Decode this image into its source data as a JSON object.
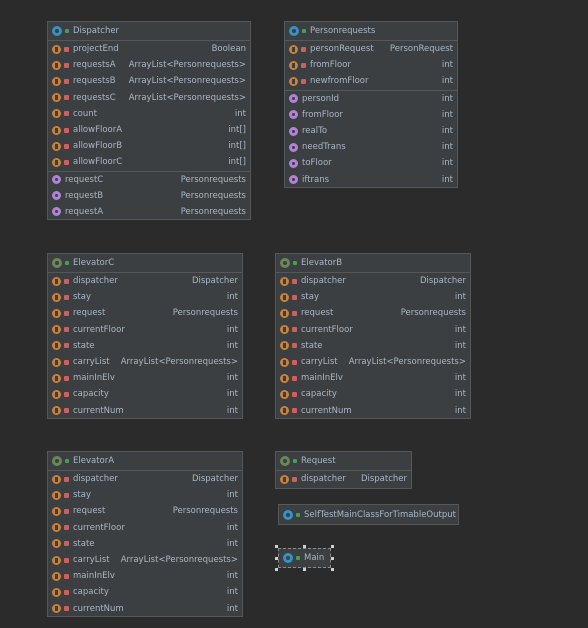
{
  "classes": {
    "dispatcher": {
      "title": "Dispatcher",
      "fields": [
        {
          "name": "projectEnd",
          "type": "Boolean"
        },
        {
          "name": "requestsA",
          "type": "ArrayList<Personrequests>"
        },
        {
          "name": "requestsB",
          "type": "ArrayList<Personrequests>"
        },
        {
          "name": "requestsC",
          "type": "ArrayList<Personrequests>"
        },
        {
          "name": "count",
          "type": "int"
        },
        {
          "name": "allowFloorA",
          "type": "int[]"
        },
        {
          "name": "allowFloorB",
          "type": "int[]"
        },
        {
          "name": "allowFloorC",
          "type": "int[]"
        }
      ],
      "methods": [
        {
          "name": "requestC",
          "type": "Personrequests"
        },
        {
          "name": "requestB",
          "type": "Personrequests"
        },
        {
          "name": "requestA",
          "type": "Personrequests"
        }
      ]
    },
    "personrequests": {
      "title": "Personrequests",
      "fields": [
        {
          "name": "personRequest",
          "type": "PersonRequest"
        },
        {
          "name": "fromFloor",
          "type": "int"
        },
        {
          "name": "newfromFloor",
          "type": "int"
        }
      ],
      "methods": [
        {
          "name": "personId",
          "type": "int"
        },
        {
          "name": "fromFloor",
          "type": "int"
        },
        {
          "name": "realTo",
          "type": "int"
        },
        {
          "name": "needTrans",
          "type": "int"
        },
        {
          "name": "toFloor",
          "type": "int"
        },
        {
          "name": "iftrans",
          "type": "int"
        }
      ]
    },
    "elevatorC": {
      "title": "ElevatorC",
      "fields": [
        {
          "name": "dispatcher",
          "type": "Dispatcher"
        },
        {
          "name": "stay",
          "type": "int"
        },
        {
          "name": "request",
          "type": "Personrequests"
        },
        {
          "name": "currentFloor",
          "type": "int"
        },
        {
          "name": "state",
          "type": "int"
        },
        {
          "name": "carryList",
          "type": "ArrayList<Personrequests>"
        },
        {
          "name": "mainInElv",
          "type": "int"
        },
        {
          "name": "capacity",
          "type": "int"
        },
        {
          "name": "currentNum",
          "type": "int"
        }
      ]
    },
    "elevatorB": {
      "title": "ElevatorB",
      "fields": [
        {
          "name": "dispatcher",
          "type": "Dispatcher"
        },
        {
          "name": "stay",
          "type": "int"
        },
        {
          "name": "request",
          "type": "Personrequests"
        },
        {
          "name": "currentFloor",
          "type": "int"
        },
        {
          "name": "state",
          "type": "int"
        },
        {
          "name": "carryList",
          "type": "ArrayList<Personrequests>"
        },
        {
          "name": "mainInElv",
          "type": "int"
        },
        {
          "name": "capacity",
          "type": "int"
        },
        {
          "name": "currentNum",
          "type": "int"
        }
      ]
    },
    "elevatorA": {
      "title": "ElevatorA",
      "fields": [
        {
          "name": "dispatcher",
          "type": "Dispatcher"
        },
        {
          "name": "stay",
          "type": "int"
        },
        {
          "name": "request",
          "type": "Personrequests"
        },
        {
          "name": "currentFloor",
          "type": "int"
        },
        {
          "name": "state",
          "type": "int"
        },
        {
          "name": "carryList",
          "type": "ArrayList<Personrequests>"
        },
        {
          "name": "mainInElv",
          "type": "int"
        },
        {
          "name": "capacity",
          "type": "int"
        },
        {
          "name": "currentNum",
          "type": "int"
        }
      ]
    },
    "request": {
      "title": "Request",
      "fields": [
        {
          "name": "dispatcher",
          "type": "Dispatcher"
        }
      ]
    },
    "selfTest": {
      "title": "SelfTestMainClassForTimableOutput"
    },
    "main": {
      "title": "Main"
    }
  }
}
